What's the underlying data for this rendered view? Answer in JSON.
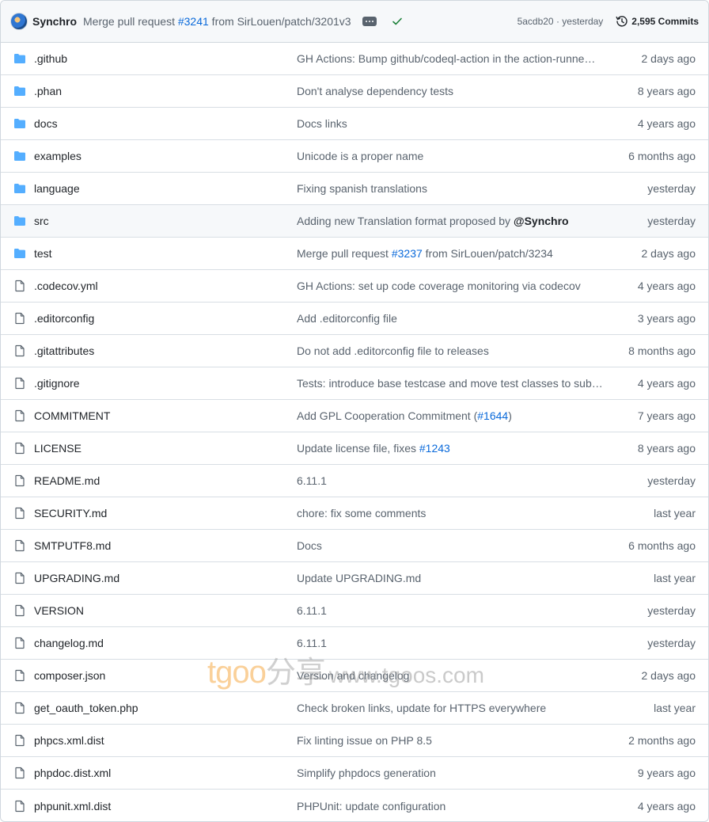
{
  "header": {
    "author": "Synchro",
    "commit_prefix": "Merge pull request ",
    "commit_pr": "#3241",
    "commit_suffix": " from SirLouen/patch/3201v3",
    "sha_time": "5acdb20 · yesterday",
    "commits_count": "2,595 Commits"
  },
  "colors": {
    "link": "#0969da",
    "folder": "#54aeff",
    "check": "#1a7f37",
    "muted": "#59636e"
  },
  "files": [
    {
      "type": "folder",
      "name": ".github",
      "message": [
        {
          "text": "GH Actions: Bump github/codeql-action in the action-runne…"
        }
      ],
      "age": "2 days ago"
    },
    {
      "type": "folder",
      "name": ".phan",
      "message": [
        {
          "text": "Don't analyse dependency tests"
        }
      ],
      "age": "8 years ago"
    },
    {
      "type": "folder",
      "name": "docs",
      "message": [
        {
          "text": "Docs links"
        }
      ],
      "age": "4 years ago"
    },
    {
      "type": "folder",
      "name": "examples",
      "message": [
        {
          "text": "Unicode is a proper name"
        }
      ],
      "age": "6 months ago"
    },
    {
      "type": "folder",
      "name": "language",
      "message": [
        {
          "text": "Fixing spanish translations"
        }
      ],
      "age": "yesterday"
    },
    {
      "type": "folder",
      "name": "src",
      "message": [
        {
          "text": "Adding new Translation format proposed by "
        },
        {
          "text": "@Synchro",
          "style": "mention"
        }
      ],
      "age": "yesterday",
      "hover": true
    },
    {
      "type": "folder",
      "name": "test",
      "message": [
        {
          "text": "Merge pull request "
        },
        {
          "text": "#3237",
          "style": "link"
        },
        {
          "text": " from SirLouen/patch/3234"
        }
      ],
      "age": "2 days ago"
    },
    {
      "type": "file",
      "name": ".codecov.yml",
      "message": [
        {
          "text": "GH Actions: set up code coverage monitoring via codecov"
        }
      ],
      "age": "4 years ago"
    },
    {
      "type": "file",
      "name": ".editorconfig",
      "message": [
        {
          "text": "Add .editorconfig file"
        }
      ],
      "age": "3 years ago"
    },
    {
      "type": "file",
      "name": ".gitattributes",
      "message": [
        {
          "text": "Do not add .editorconfig file to releases"
        }
      ],
      "age": "8 months ago"
    },
    {
      "type": "file",
      "name": ".gitignore",
      "message": [
        {
          "text": "Tests: introduce base testcase and move test classes to subdi…"
        }
      ],
      "age": "4 years ago"
    },
    {
      "type": "file",
      "name": "COMMITMENT",
      "message": [
        {
          "text": "Add GPL Cooperation Commitment ("
        },
        {
          "text": "#1644",
          "style": "link"
        },
        {
          "text": ")"
        }
      ],
      "age": "7 years ago"
    },
    {
      "type": "file",
      "name": "LICENSE",
      "message": [
        {
          "text": "Update license file, "
        },
        {
          "text": "fixes",
          "style": "dotted"
        },
        {
          "text": " "
        },
        {
          "text": "#1243",
          "style": "link"
        }
      ],
      "age": "8 years ago"
    },
    {
      "type": "file",
      "name": "README.md",
      "message": [
        {
          "text": "6.11.1"
        }
      ],
      "age": "yesterday"
    },
    {
      "type": "file",
      "name": "SECURITY.md",
      "message": [
        {
          "text": "chore: fix some comments"
        }
      ],
      "age": "last year"
    },
    {
      "type": "file",
      "name": "SMTPUTF8.md",
      "message": [
        {
          "text": "Docs"
        }
      ],
      "age": "6 months ago"
    },
    {
      "type": "file",
      "name": "UPGRADING.md",
      "message": [
        {
          "text": "Update UPGRADING.md"
        }
      ],
      "age": "last year"
    },
    {
      "type": "file",
      "name": "VERSION",
      "message": [
        {
          "text": "6.11.1"
        }
      ],
      "age": "yesterday"
    },
    {
      "type": "file",
      "name": "changelog.md",
      "message": [
        {
          "text": "6.11.1"
        }
      ],
      "age": "yesterday"
    },
    {
      "type": "file",
      "name": "composer.json",
      "message": [
        {
          "text": "Version and changelog"
        }
      ],
      "age": "2 days ago"
    },
    {
      "type": "file",
      "name": "get_oauth_token.php",
      "message": [
        {
          "text": "Check broken links, update for HTTPS everywhere"
        }
      ],
      "age": "last year"
    },
    {
      "type": "file",
      "name": "phpcs.xml.dist",
      "message": [
        {
          "text": "Fix linting issue on PHP 8.5"
        }
      ],
      "age": "2 months ago"
    },
    {
      "type": "file",
      "name": "phpdoc.dist.xml",
      "message": [
        {
          "text": "Simplify phpdocs generation"
        }
      ],
      "age": "9 years ago"
    },
    {
      "type": "file",
      "name": "phpunit.xml.dist",
      "message": [
        {
          "text": "PHPUnit: update configuration"
        }
      ],
      "age": "4 years ago"
    }
  ],
  "watermark": {
    "brand": "tgoo",
    "cn": "分享",
    "url": "www.tgoos.com"
  }
}
